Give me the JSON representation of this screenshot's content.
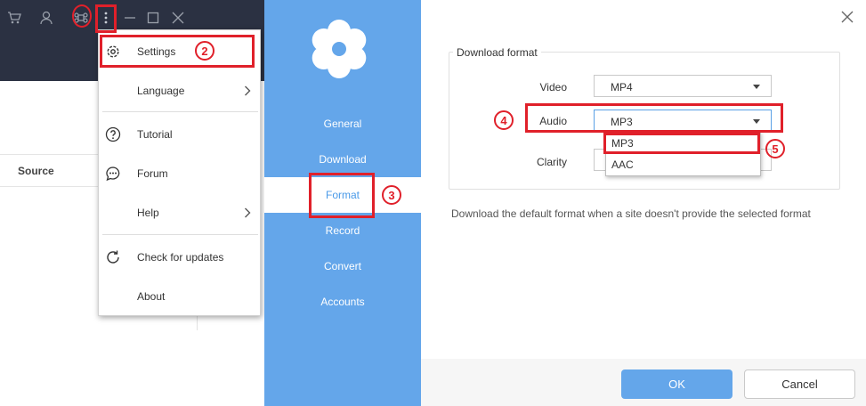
{
  "left_app": {
    "table": {
      "source_header": "Source"
    }
  },
  "menu": {
    "items": [
      {
        "label": "Settings",
        "icon": "gear-icon"
      },
      {
        "label": "Language",
        "icon": "",
        "submenu": true
      },
      {
        "label": "Tutorial",
        "icon": "question-icon"
      },
      {
        "label": "Forum",
        "icon": "chat-icon"
      },
      {
        "label": "Help",
        "icon": "",
        "submenu": true
      },
      {
        "label": "Check for updates",
        "icon": "refresh-icon"
      },
      {
        "label": "About",
        "icon": ""
      }
    ]
  },
  "settings": {
    "nav": [
      {
        "label": "General"
      },
      {
        "label": "Download"
      },
      {
        "label": "Format",
        "active": true
      },
      {
        "label": "Record"
      },
      {
        "label": "Convert"
      },
      {
        "label": "Accounts"
      }
    ],
    "group_title": "Download format",
    "fields": {
      "video": {
        "label": "Video",
        "value": "MP4"
      },
      "audio": {
        "label": "Audio",
        "value": "MP3",
        "options": [
          "MP3",
          "AAC"
        ]
      },
      "clarity": {
        "label": "Clarity",
        "value": ""
      }
    },
    "hint": "Download the default format when a site doesn't provide the selected format",
    "ok_label": "OK",
    "cancel_label": "Cancel"
  },
  "annotations": {
    "steps": [
      "2",
      "3",
      "4",
      "5"
    ]
  },
  "colors": {
    "titlebar": "#2b3142",
    "sidebar": "#64a6ea",
    "accent": "#4a9ae8",
    "annotation": "#e0202a"
  }
}
